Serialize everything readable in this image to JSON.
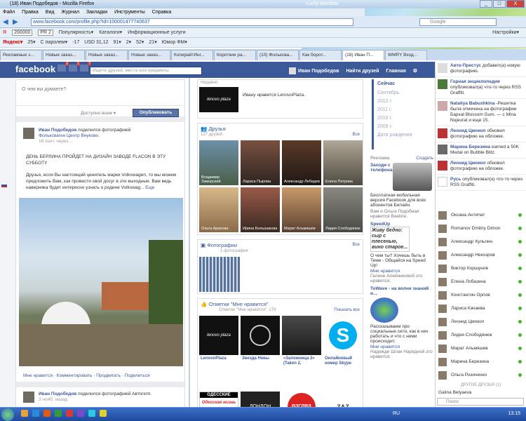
{
  "browser": {
    "title": "(18) Иван Подобедов - Mozilla Firefox",
    "brand_overlay": "Lucky Bamboo",
    "menu": [
      "Файл",
      "Правка",
      "Вид",
      "Журнал",
      "Закладки",
      "Инструменты",
      "Справка"
    ],
    "url": "www.facebook.com/profile.php?id=100001477740637",
    "search_placeholder": "Google",
    "win_min": "_",
    "win_max": "□",
    "win_close": "X"
  },
  "toolbar1": {
    "yandex_value": "200000",
    "pr": "PR 2",
    "items": [
      "Популярность▾",
      "Каталоги▾",
      "Информационные услуги"
    ],
    "settings": "Настройки▾"
  },
  "toolbar2": {
    "brand": "Яндекс▾",
    "items": [
      "25▾",
      "С паролем▾",
      "-17",
      "USD 31,12",
      "91▾",
      "2▾",
      "52▾",
      "21▾",
      "Юмор ФМ▾"
    ]
  },
  "tabs": [
    "Рекламные з...",
    "Новые заказ...",
    "Новые заказ...",
    "Новые заказ...",
    "КопирайтИнг...",
    "Короткие ра...",
    "(10) Фольксва...",
    "Как борот...",
    "(18) Иван П...",
    "WMRY Вход..."
  ],
  "facebook": {
    "logo": "facebook",
    "badge_1": "2",
    "badge_2": "1",
    "badge_3": "7",
    "search_placeholder": "Ищите друзей, места или предметы",
    "nav_user": "Иван Подобедов",
    "nav_find": "Найти друзей",
    "nav_home": "Главная"
  },
  "composer": {
    "placeholder": "О чем вы думаете?",
    "audience": "Доступно всем ▾",
    "post_button": "Опубликовать"
  },
  "post": {
    "author": "Иван Подобедов",
    "action": " поделился фотографией",
    "subtitle": "Фольксваген Центр Внуково.",
    "time": "16 сент. через ...",
    "headline": "ДЕНЬ БЕРЛИНА ПРОЙДЕТ НА ДИЗАЙН ЗАВОДЕ FLACON В ЭТУ СУББОТУ",
    "body": "Друзья, если Вы настоящий ценитель марки Volkswagen, то мы можем предложить Вам, как провести свой досуг в эти выходные. Вам ведь наверняка будет интересно узнать о родине Volkswag...",
    "more": "Еще",
    "actions": [
      "Мне нравится",
      "Комментировать",
      "Продвигать",
      "Поделиться"
    ]
  },
  "post2": {
    "author": "Иван Подобедов",
    "action": " поделился фотографией Автогетп.",
    "time": "3 нояб. назад"
  },
  "center": {
    "liked_header": "Недавно",
    "liked_text": "Ивану нравится LenovoPlaza.",
    "lenovo_logo": "lenovo plaza",
    "friends_title": "Друзья",
    "friends_count": "127 друзей",
    "friends_all": "Все",
    "friends": [
      "Владимир Заморский",
      "Лариса Пырова",
      "Александр Лебедев",
      "Елена Петрова",
      "Ольга Арапова",
      "Ирина Большакова",
      "Марат Альмяшев",
      "Лидия Слободянюк"
    ],
    "photos_title": "Фотографии",
    "photos_count": "1 фотография",
    "photos_all": "Все",
    "likes_title": "Отметки \"Мне нравится\"",
    "likes_sub": "Отметки \"Мне нравится\": 179",
    "likes_all": "Показать все",
    "likes": [
      "LenovoPlaza",
      "Звезда Невы",
      "«Заложница 2» (Taken 2,",
      "Онлайновый номер Skype"
    ],
    "likes_row2": [
      "ОДЕССКИЕ",
      "Одесская жизнь",
      "ЛОНДОН",
      "ВЗГЛЯД",
      "ZAZ"
    ]
  },
  "years": {
    "now": "Сейчас",
    "items": [
      "Сентябрь",
      "2012 г.",
      "2011 г.",
      "2010 г.",
      "2009 г."
    ],
    "birth": "Дата рождения"
  },
  "ads": {
    "header": "Реклама",
    "create": "Создать",
    "ad1_title": "Заходи с телефона!",
    "ad1_body": "Бесплатная мобильная версия Facebook для всех абонентов Билайн.",
    "ad1_social": "Вам и Ольга Подобная нравится Beeline.",
    "ad2_title": "SpeedUp",
    "ad2_img": "Живу бедно: сыр с плесенью, вино старое...",
    "ad2_body": "О чем ты? Хочешь быть в Теме - Общайся на Speed Up!",
    "ad2_like": "Мне нравится",
    "ad2_social": "Галине Алейниковой это нравится.",
    "ad3_title": "ToWave - на волне знаний и...",
    "ad3_body": "Рассказываем про социальные сети, как в них работать и что с ними происходит.",
    "ad3_like": "Мне нравится",
    "ad3_social": "Надежде Шлак Нарядной это нравится."
  },
  "ticker": [
    {
      "name": "Авто-Престус",
      "text": " добавил(а) новую фотографию."
    },
    {
      "name": "Горная энциклопедия",
      "text": " опубликовал(а) что-то через RSS Graffiti."
    },
    {
      "name": "Nataliya Babushkina",
      "text": " -Решетка была отмечена на фотографии Бархаt Blossom Gum. — с Mina Nujeurat и еще 15."
    },
    {
      "name": "Леонид Цмокол",
      "text": " обновил фотографию на обложке."
    },
    {
      "name": "Марина Березина",
      "text": " earned a 50K Medal on Bubble Blitz."
    },
    {
      "name": "Леонид Цмокол",
      "text": " обновил фотографию на обложке."
    },
    {
      "name": "Русь",
      "text": " опубликовал(а) что-то через RSS Graffiti."
    }
  ],
  "chat": {
    "friends": [
      "Оксана Антипат",
      "Romanov Dmitriy Dimon",
      "Александр Кульпин",
      "Александр Некозров",
      "Виктор Коршунов",
      "Елена Лобазина",
      "Константин Орлов",
      "Лариса Качаева",
      "Леонид Цмокол",
      "Лидия Слободянюк",
      "Марат Альмяшев",
      "Марина Березина",
      "Ольга Розиченко"
    ],
    "other_header": "ДРУГИЕ ДРУЗЬЯ (1)",
    "other": "Galina Belyaeva",
    "search_placeholder": "Поиск"
  },
  "taskbar": {
    "start": "Пуск",
    "lang": "RU",
    "time": "13:15"
  }
}
